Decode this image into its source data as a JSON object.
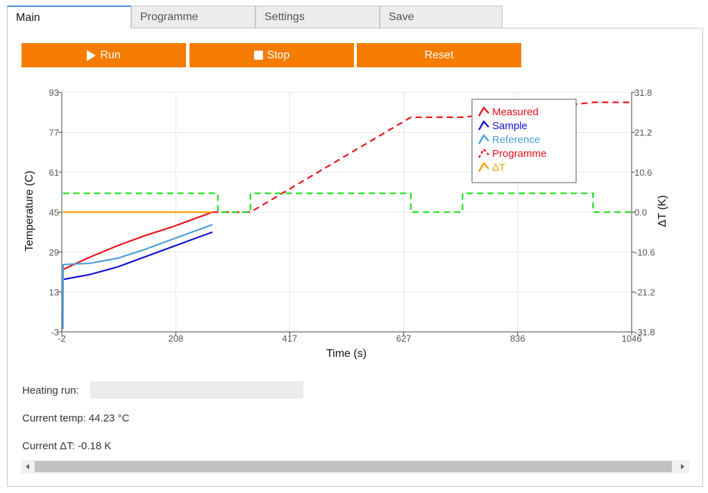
{
  "tabs": [
    {
      "label": "Main",
      "active": true
    },
    {
      "label": "Programme",
      "active": false
    },
    {
      "label": "Settings",
      "active": false
    },
    {
      "label": "Save",
      "active": false
    }
  ],
  "buttons": {
    "run": "Run",
    "stop": "Stop",
    "reset": "Reset"
  },
  "colors": {
    "accent": "#f57c00",
    "tab_active_border": "#4a90d9"
  },
  "icons": {
    "run": "play-icon",
    "stop": "stop-icon"
  },
  "chart_data": {
    "type": "line",
    "xlabel": "Time (s)",
    "ylabel": "Temperature (C)",
    "y2label": "ΔT (K)",
    "xlim": [
      -2,
      1046
    ],
    "ylim": [
      -3,
      93
    ],
    "y2lim": [
      -31.8,
      31.8
    ],
    "xticks": [
      "-2",
      "208",
      "417",
      "627",
      "836",
      "1046"
    ],
    "yticks": [
      "93",
      "77",
      "61",
      "45",
      "29",
      "13",
      "-3"
    ],
    "y2ticks": [
      "31.8",
      "21.2",
      "10.6",
      "0.0",
      "-10.6",
      "-21.2",
      "-31.8"
    ],
    "grid": true,
    "legend_position": "top-right",
    "series": [
      {
        "name": "Measured",
        "color": "#e8101a",
        "axis": "left",
        "style": "solid",
        "x": [
          0,
          50,
          100,
          150,
          200,
          250,
          275
        ],
        "y": [
          22,
          27,
          31.5,
          35.5,
          39,
          43,
          45
        ]
      },
      {
        "name": "Sample",
        "color": "#1010d0",
        "axis": "left",
        "style": "solid",
        "x": [
          0,
          50,
          100,
          150,
          200,
          250,
          275
        ],
        "y": [
          18,
          20,
          23,
          27,
          31,
          35,
          37
        ]
      },
      {
        "name": "Reference",
        "color": "#4a9ed8",
        "axis": "left",
        "style": "solid",
        "x": [
          0,
          0.5,
          50,
          100,
          150,
          200,
          250,
          275
        ],
        "y": [
          -2,
          24,
          24.5,
          26.5,
          30,
          34,
          38,
          40
        ]
      },
      {
        "name": "Programme",
        "color": "#e8101a",
        "axis": "left",
        "style": "dashed",
        "x": [
          275,
          345,
          640,
          735,
          975,
          1046
        ],
        "y": [
          45,
          45,
          83,
          83,
          89,
          89
        ]
      },
      {
        "name": "ΔT",
        "color": "#f0a000",
        "axis": "right",
        "style": "solid",
        "x": [
          0,
          275
        ],
        "y": [
          0,
          0
        ]
      },
      {
        "name": "",
        "color": "#22dd22",
        "axis": "right",
        "style": "dashed",
        "x": [
          0,
          285,
          285,
          345,
          345,
          640,
          640,
          735,
          735,
          975,
          975,
          1046
        ],
        "y": [
          5,
          5,
          0,
          0,
          5,
          5,
          0,
          0,
          5,
          5,
          0,
          0
        ]
      }
    ]
  },
  "info": {
    "heating_label": "Heating run:",
    "heating_progress": 0,
    "current_temp": "Current temp: 44.23 °C",
    "current_dt": "Current ΔT: -0.18 K"
  }
}
